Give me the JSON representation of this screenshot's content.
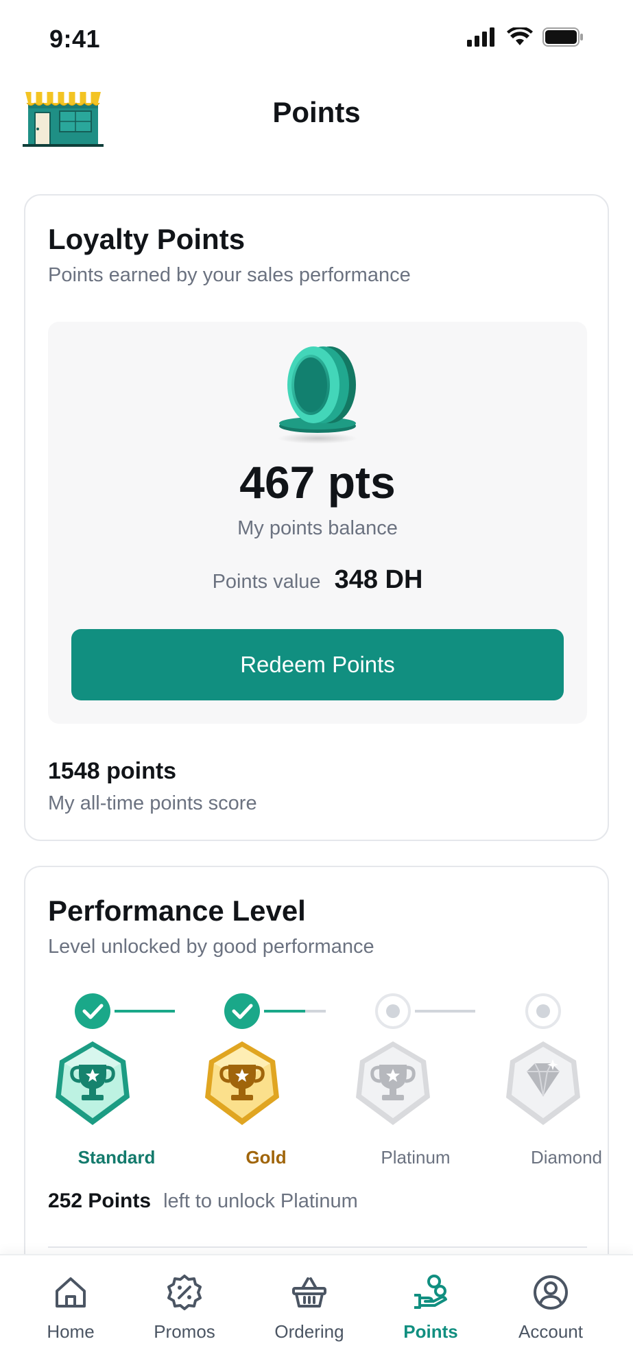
{
  "status_bar": {
    "time": "9:41"
  },
  "header": {
    "title": "Points"
  },
  "loyalty": {
    "title": "Loyalty Points",
    "subtitle": "Points earned by your sales performance",
    "balance": "467 pts",
    "balance_label": "My points balance",
    "value_label": "Points value",
    "value_amount": "348 DH",
    "redeem_label": "Redeem Points",
    "alltime_value": "1548 points",
    "alltime_label": "My all-time points score"
  },
  "performance": {
    "title": "Performance Level",
    "subtitle": "Level unlocked by good performance",
    "levels": [
      {
        "name": "Standard",
        "status": "completed"
      },
      {
        "name": "Gold",
        "status": "completed"
      },
      {
        "name": "Platinum",
        "status": "locked"
      },
      {
        "name": "Diamond",
        "status": "locked"
      }
    ],
    "progress_fraction_gold_to_platinum": 0.5,
    "unlock_points": "252 Points",
    "unlock_text": "left to unlock Platinum"
  },
  "bottom_nav": {
    "items": [
      {
        "label": "Home",
        "icon": "home-icon",
        "active": false
      },
      {
        "label": "Promos",
        "icon": "percent-badge-icon",
        "active": false
      },
      {
        "label": "Ordering",
        "icon": "basket-icon",
        "active": false
      },
      {
        "label": "Points",
        "icon": "hand-coins-icon",
        "active": true
      },
      {
        "label": "Account",
        "icon": "user-circle-icon",
        "active": false
      }
    ]
  },
  "colors": {
    "primary": "#118f80",
    "standard": "#137a6c",
    "gold": "#a0650b",
    "muted": "#6b7280",
    "inactive_track": "#d1d5db"
  }
}
